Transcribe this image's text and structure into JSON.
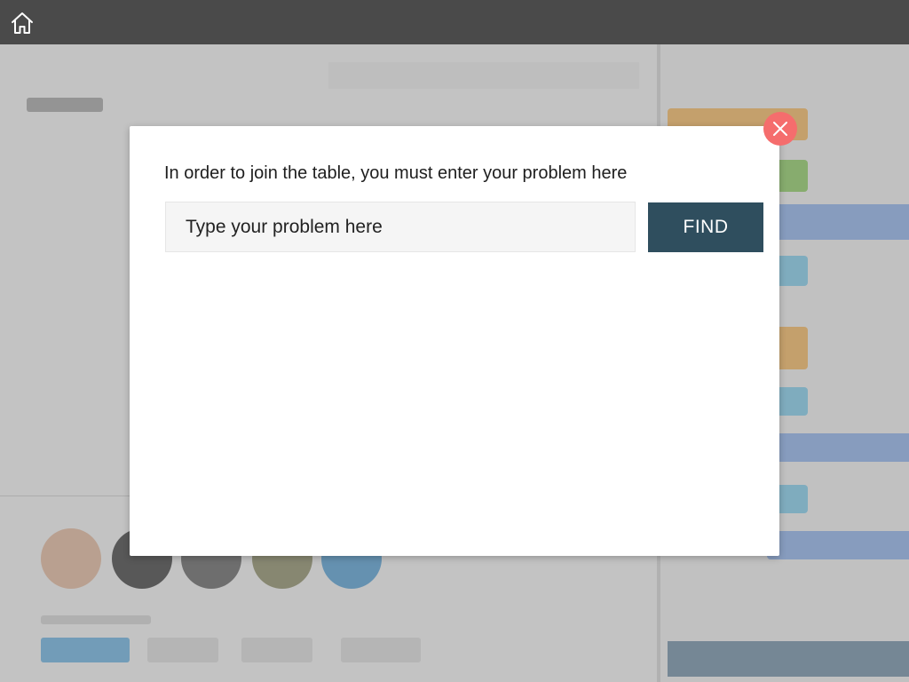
{
  "topbar": {
    "home_icon": "home-icon"
  },
  "colors": {
    "topbar": "#4a4a4a",
    "find_button": "#2f4e5e",
    "close_button": "#f56d6d"
  },
  "modal": {
    "message": "In order to join the table, you must enter your problem here",
    "input": {
      "placeholder": "Type your problem here",
      "value": ""
    },
    "find_label": "FIND",
    "close_icon": "close-icon"
  }
}
